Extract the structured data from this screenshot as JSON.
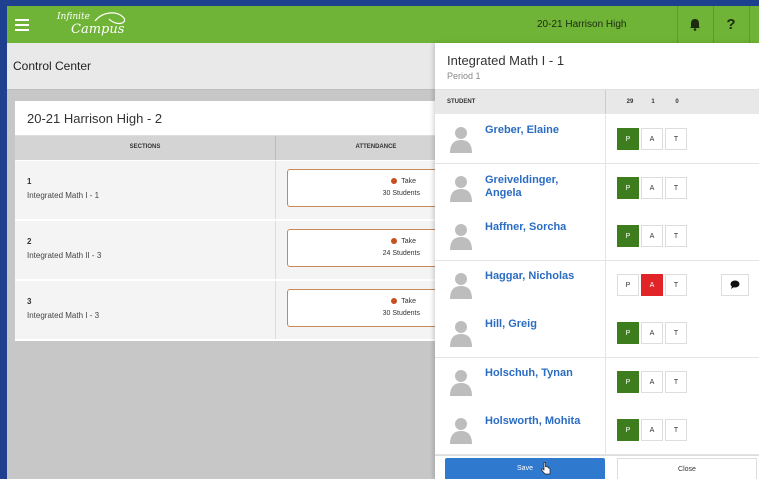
{
  "app": {
    "logo_top": "Infinite",
    "logo_bottom": "Campus",
    "school_name": "20-21 Harrison High"
  },
  "left": {
    "page_title": "Control Center",
    "card_title": "20-21 Harrison High - 2",
    "col_sections": "SECTIONS",
    "col_attendance": "ATTENDANCE",
    "rows": [
      {
        "period": "1",
        "name": "Integrated Math I - 1",
        "take": "Take",
        "students": "30 Students"
      },
      {
        "period": "2",
        "name": "Integrated Math II - 3",
        "take": "Take",
        "students": "24 Students"
      },
      {
        "period": "3",
        "name": "Integrated Math I - 3",
        "take": "Take",
        "students": "30 Students"
      }
    ]
  },
  "panel": {
    "title": "Integrated Math I - 1",
    "subtitle": "Period 1",
    "col_student": "STUDENT",
    "count_present": "29",
    "count_absent": "1",
    "count_tardy": "0",
    "btn_p": "P",
    "btn_a": "A",
    "btn_t": "T",
    "students": [
      {
        "name": "Greber, Elaine",
        "status": "P"
      },
      {
        "name": "Greiveldinger, Angela",
        "status": "P"
      },
      {
        "name": "Haffner, Sorcha",
        "status": "P"
      },
      {
        "name": "Haggar, Nicholas",
        "status": "A"
      },
      {
        "name": "Hill, Greig",
        "status": "P"
      },
      {
        "name": "Holschuh, Tynan",
        "status": "P"
      },
      {
        "name": "Holsworth, Mohita",
        "status": "P"
      }
    ],
    "save_label": "Save",
    "close_label": "Close"
  },
  "colors": {
    "topbar": "#6fb436",
    "present": "#3d7d1e",
    "absent": "#e02428",
    "link": "#2a6cc2",
    "save": "#2f79cf"
  }
}
